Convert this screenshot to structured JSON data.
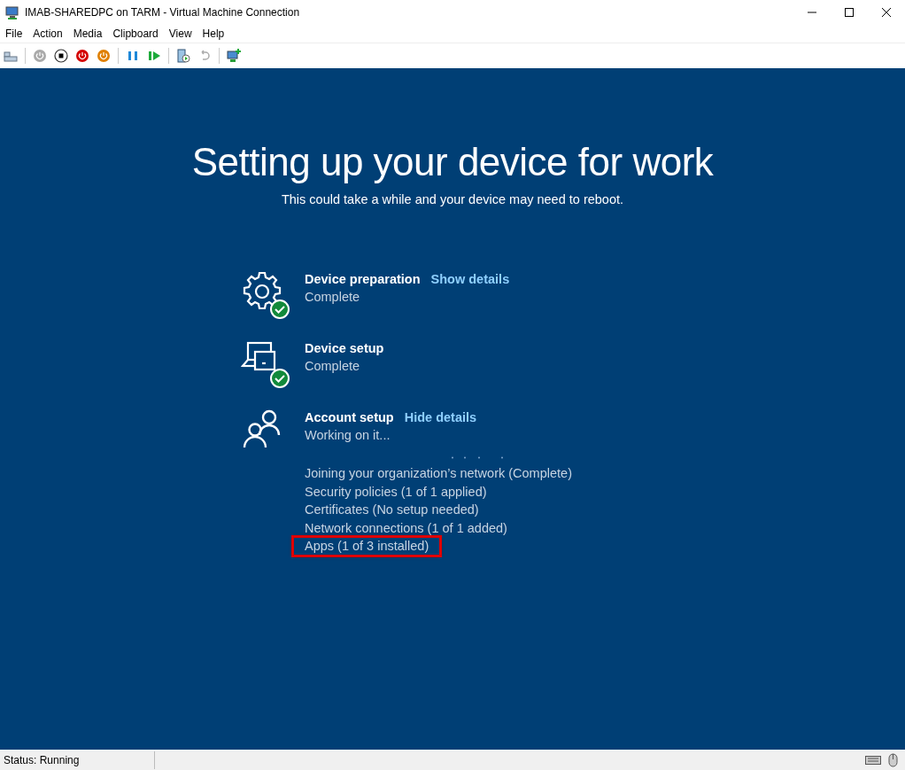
{
  "window": {
    "title": "IMAB-SHAREDPC on TARM - Virtual Machine Connection"
  },
  "menu": [
    "File",
    "Action",
    "Media",
    "Clipboard",
    "View",
    "Help"
  ],
  "toolbar": [
    {
      "kind": "ctrl-alt-del"
    },
    {
      "kind": "separator"
    },
    {
      "kind": "power"
    },
    {
      "kind": "stop"
    },
    {
      "kind": "power-red"
    },
    {
      "kind": "power-orange"
    },
    {
      "kind": "separator"
    },
    {
      "kind": "pause"
    },
    {
      "kind": "play"
    },
    {
      "kind": "separator"
    },
    {
      "kind": "checkpoint"
    },
    {
      "kind": "revert"
    },
    {
      "kind": "separator"
    },
    {
      "kind": "session"
    }
  ],
  "screen": {
    "title": "Setting up your device for work",
    "subtitle": "This could take a while and your device may need to reboot.",
    "steps": [
      {
        "title": "Device preparation",
        "link": "Show details",
        "status": "Complete",
        "complete": true
      },
      {
        "title": "Device setup",
        "status": "Complete",
        "complete": true
      },
      {
        "title": "Account setup",
        "link": "Hide details",
        "status": "Working on it...",
        "complete": false,
        "in_progress": true,
        "details": [
          {
            "text": "Joining your organization’s network (Complete)",
            "highlighted": false
          },
          {
            "text": "Security policies (1 of 1 applied)",
            "highlighted": false
          },
          {
            "text": "Certificates (No setup needed)",
            "highlighted": false
          },
          {
            "text": "Network connections (1 of 1 added)",
            "highlighted": false
          },
          {
            "text": "Apps (1 of 3 installed)",
            "highlighted": true
          }
        ]
      }
    ]
  },
  "status_bar": {
    "text": "Status: Running"
  }
}
